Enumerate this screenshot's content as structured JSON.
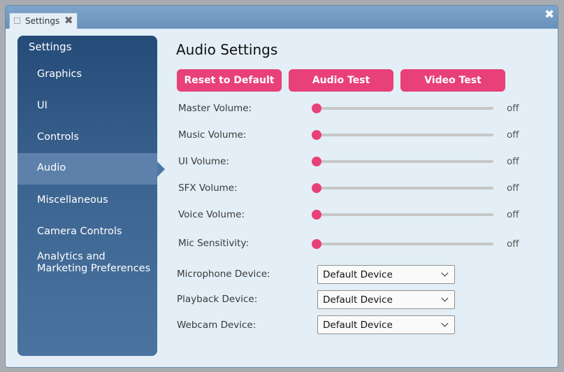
{
  "window": {
    "tab_label": "Settings"
  },
  "sidebar": {
    "title": "Settings",
    "items": [
      {
        "label": "Graphics",
        "active": false
      },
      {
        "label": "UI",
        "active": false
      },
      {
        "label": "Controls",
        "active": false
      },
      {
        "label": "Audio",
        "active": true
      },
      {
        "label": "Miscellaneous",
        "active": false
      },
      {
        "label": "Camera Controls",
        "active": false
      },
      {
        "label_line1": "Analytics and",
        "label_line2": "Marketing Preferences",
        "active": false
      }
    ]
  },
  "main": {
    "heading": "Audio Settings",
    "buttons": {
      "reset": "Reset to Default",
      "audio_test": "Audio Test",
      "video_test": "Video Test"
    },
    "sliders": [
      {
        "label": "Master Volume:",
        "value": "off",
        "level": 0
      },
      {
        "label": "Music Volume:",
        "value": "off",
        "level": 0
      },
      {
        "label": "UI Volume:",
        "value": "off",
        "level": 0
      },
      {
        "label": "SFX Volume:",
        "value": "off",
        "level": 0
      },
      {
        "label": "Voice Volume:",
        "value": "off",
        "level": 0
      },
      {
        "label": "Mic Sensitivity:",
        "value": "off",
        "level": 0
      }
    ],
    "devices": [
      {
        "label": "Microphone Device:",
        "selected": "Default Device"
      },
      {
        "label": "Playback Device:",
        "selected": "Default Device"
      },
      {
        "label": "Webcam Device:",
        "selected": "Default Device"
      }
    ]
  },
  "colors": {
    "accent": "#e84079",
    "sidebar_top": "#254b78",
    "sidebar_bottom": "#4a73a0",
    "panel_bg": "#e3eef6",
    "titlebar": "#6f97c1"
  },
  "icons": {
    "tab_icon": "settings-tab-icon",
    "tab_close": "close-icon",
    "window_close": "close-icon",
    "dropdown": "chevron-down-icon"
  }
}
